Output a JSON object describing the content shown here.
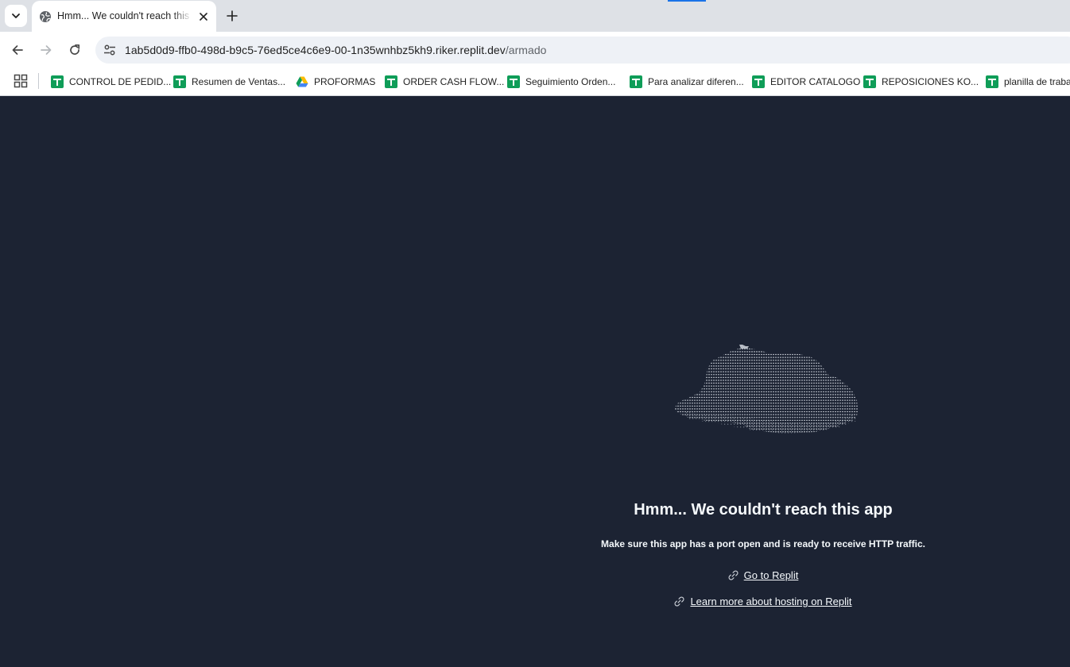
{
  "browser": {
    "tab": {
      "title": "Hmm... We couldn't reach this app",
      "favicon": "globe-icon"
    },
    "url": {
      "host": "1ab5d0d9-ffb0-498d-b9c5-76ed5ce4c6e9-00-1n35wnhbz5kh9.riker.replit.dev",
      "path": "/armado"
    },
    "bookmarks": [
      {
        "label": "CONTROL DE PEDID...",
        "icon": "google-sheets-icon"
      },
      {
        "label": "Resumen de Ventas...",
        "icon": "google-sheets-icon"
      },
      {
        "label": "PROFORMAS",
        "icon": "google-drive-icon"
      },
      {
        "label": "ORDER CASH FLOW...",
        "icon": "google-sheets-icon"
      },
      {
        "label": "Seguimiento Orden...",
        "icon": "google-sheets-icon"
      },
      {
        "label": "Para analizar diferen...",
        "icon": "google-sheets-icon"
      },
      {
        "label": "EDITOR CATALOGO",
        "icon": "google-sheets-icon"
      },
      {
        "label": "REPOSICIONES KO...",
        "icon": "google-sheets-icon"
      },
      {
        "label": "planilla de traba",
        "icon": "google-sheets-icon"
      }
    ]
  },
  "page": {
    "title": "Hmm... We couldn't reach this app",
    "subtitle": "Make sure this app has a port open and is ready to receive HTTP traffic.",
    "links": [
      {
        "label": "Go to Replit",
        "icon": "link-icon"
      },
      {
        "label": "Learn more about hosting on Replit",
        "icon": "link-icon"
      }
    ]
  },
  "colors": {
    "page_background": "#1c2333",
    "text": "#f5f9fc",
    "accent": "#1a73e8"
  }
}
